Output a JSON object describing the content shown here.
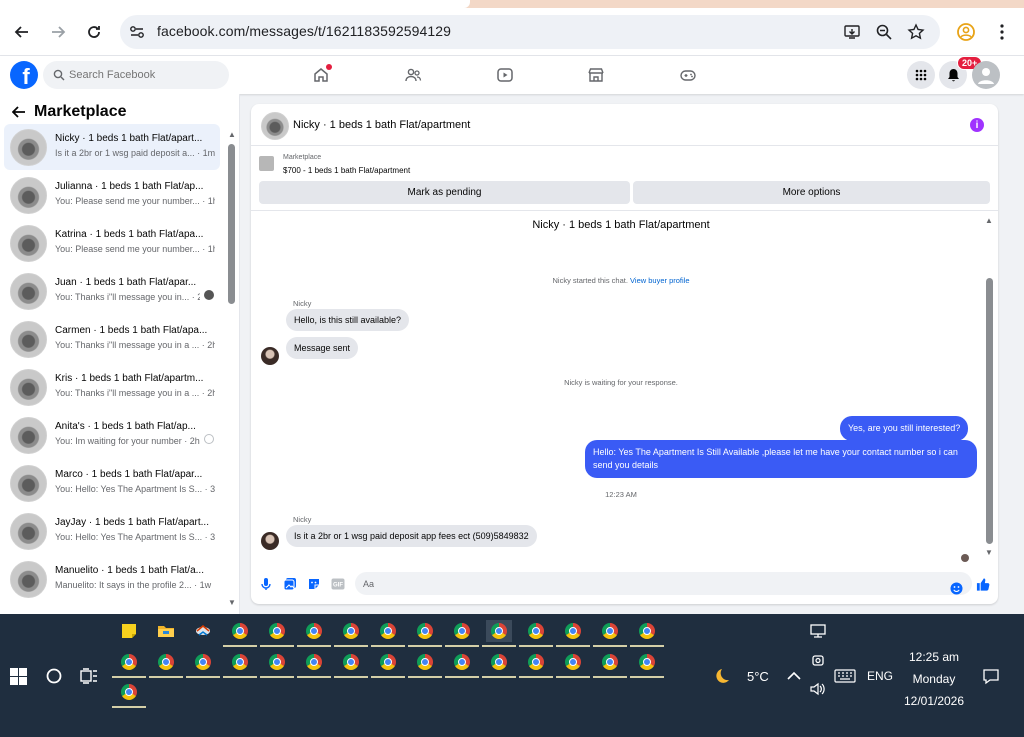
{
  "browser": {
    "url": "facebook.com/messages/t/1621183592594129"
  },
  "fb": {
    "search_placeholder": "Search Facebook",
    "notif_badge": "20+"
  },
  "left": {
    "title": "Marketplace",
    "conversations": [
      {
        "name": "Nicky · 1 beds 1 bath Flat/apart...",
        "preview": "Is it a 2br or 1 wsg paid deposit a... · 1m"
      },
      {
        "name": "Julianna · 1 beds 1 bath Flat/ap...",
        "preview": "You: Please send me your number... · 1h"
      },
      {
        "name": "Katrina · 1 beds 1 bath Flat/apa...",
        "preview": "You: Please send me your number... · 1h"
      },
      {
        "name": "Juan · 1 beds 1 bath Flat/apar...",
        "preview": "You: Thanks i\"ll message you in... · 2h"
      },
      {
        "name": "Carmen · 1 beds 1 bath Flat/apa...",
        "preview": "You: Thanks i\"ll message you in a ... · 2h"
      },
      {
        "name": "Kris · 1 beds 1 bath Flat/apartm...",
        "preview": "You: Thanks i\"ll message you in a ... · 2h"
      },
      {
        "name": "Anita's · 1 beds 1 bath Flat/ap...",
        "preview": "You: Im waiting for your number · 2h"
      },
      {
        "name": "Marco · 1 beds 1 bath Flat/apar...",
        "preview": "You: Hello: Yes The Apartment Is S... · 3h"
      },
      {
        "name": "JayJay · 1 beds 1 bath Flat/apart...",
        "preview": "You: Hello: Yes The Apartment Is S... · 3h"
      },
      {
        "name": "Manuelito · 1 beds 1 bath Flat/a...",
        "preview": "Manuelito: It says in the profile 2... · 1w"
      }
    ]
  },
  "chat": {
    "header_title": "Nicky · 1 beds 1 bath Flat/apartment",
    "listing_label": "Marketplace",
    "listing_price": "$700 - 1 beds 1 bath Flat/apartment",
    "btn_pending": "Mark as pending",
    "btn_more": "More options",
    "thread_title": "Nicky · 1 beds 1 bath Flat/apartment",
    "sys_started": "Nicky started this chat.",
    "sys_view_profile": "View buyer profile",
    "sender_1": "Nicky",
    "msg_in_1": "Hello, is this still available?",
    "msg_in_2": "Message sent",
    "sys_waiting": "Nicky is waiting for your response.",
    "msg_out_1": "Yes, are you still interested?",
    "msg_out_2": "Hello: Yes The Apartment Is Still Available ,please let me have your contact number so i can send you details",
    "time_stamp": "12:23 AM",
    "sender_2": "Nicky",
    "msg_in_3": "Is it a 2br or 1 wsg paid deposit app fees ect (509)5849832",
    "composer_placeholder": "Aa"
  },
  "taskbar": {
    "weather_temp": "5°C",
    "lang": "ENG",
    "time": "12:25 am",
    "day": "Monday",
    "date": "12/01/2026"
  },
  "colors": {
    "fb_blue": "#0866ff",
    "outgoing_bubble": "#3a5bf5",
    "taskbar_bg": "#1f2e3f"
  }
}
